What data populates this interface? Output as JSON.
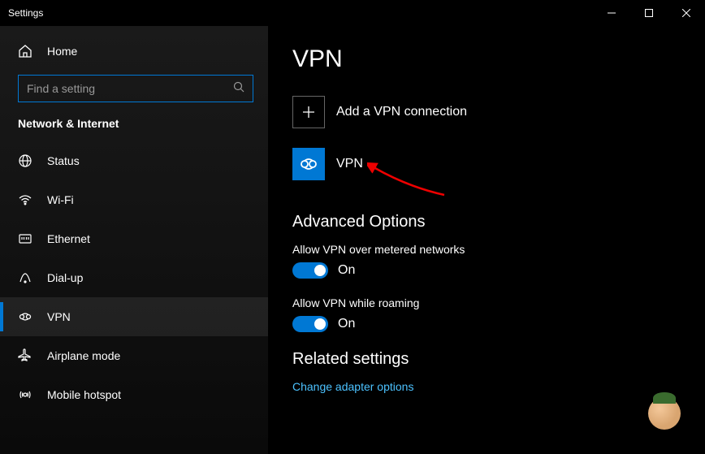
{
  "window": {
    "title": "Settings"
  },
  "sidebar": {
    "home": "Home",
    "search_placeholder": "Find a setting",
    "category": "Network & Internet",
    "items": [
      {
        "label": "Status"
      },
      {
        "label": "Wi-Fi"
      },
      {
        "label": "Ethernet"
      },
      {
        "label": "Dial-up"
      },
      {
        "label": "VPN"
      },
      {
        "label": "Airplane mode"
      },
      {
        "label": "Mobile hotspot"
      }
    ]
  },
  "main": {
    "title": "VPN",
    "add_label": "Add a VPN connection",
    "vpn_item_label": "VPN",
    "advanced_title": "Advanced Options",
    "option_metered_label": "Allow VPN over metered networks",
    "option_metered_state": "On",
    "option_roaming_label": "Allow VPN while roaming",
    "option_roaming_state": "On",
    "related_title": "Related settings",
    "related_link": "Change adapter options"
  }
}
